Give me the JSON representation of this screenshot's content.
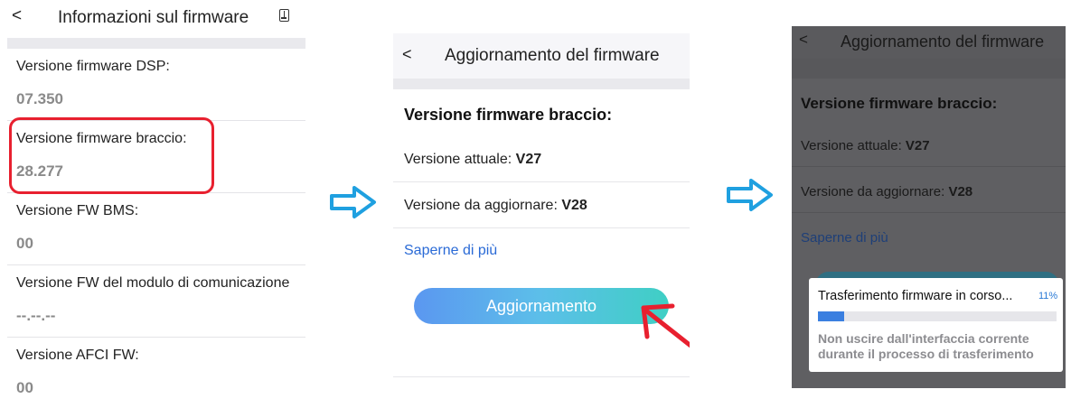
{
  "panel1": {
    "back": "<",
    "title": "Informazioni sul firmware",
    "export_icon": "export-icon",
    "rows": [
      {
        "label": "Versione firmware DSP:",
        "value": "07.350"
      },
      {
        "label": "Versione firmware braccio:",
        "value": "28.277"
      },
      {
        "label": "Versione FW BMS:",
        "value": "00"
      },
      {
        "label": "Versione FW del modulo di comunicazione",
        "value": "--.--.--"
      },
      {
        "label": "Versione AFCI FW:",
        "value": "00"
      }
    ],
    "highlight_color": "#e8202f"
  },
  "arrows": {
    "color": "#1fa0e0",
    "icon": "right-arrow-icon"
  },
  "panel2": {
    "back": "<",
    "title": "Aggiornamento del firmware",
    "section": "Versione firmware braccio:",
    "current_label": "Versione attuale:",
    "current_value": "V27",
    "target_label": "Versione da aggiornare:",
    "target_value": "V28",
    "learn_more": "Saperne di più",
    "update_button": "Aggiornamento",
    "annotation_arrow_color": "#e8202f"
  },
  "panel3": {
    "back": "<",
    "title": "Aggiornamento del firmware",
    "section": "Versione firmware braccio:",
    "current_label": "Versione attuale:",
    "current_value": "V27",
    "target_label": "Versione da aggiornare:",
    "target_value": "V28",
    "learn_more": "Saperne di più",
    "dialog": {
      "title": "Trasferimento firmware in corso...",
      "percent_text": "11%",
      "progress": 0.11,
      "message": "Non uscire dall'interfaccia corrente durante il processo di trasferimento"
    }
  }
}
